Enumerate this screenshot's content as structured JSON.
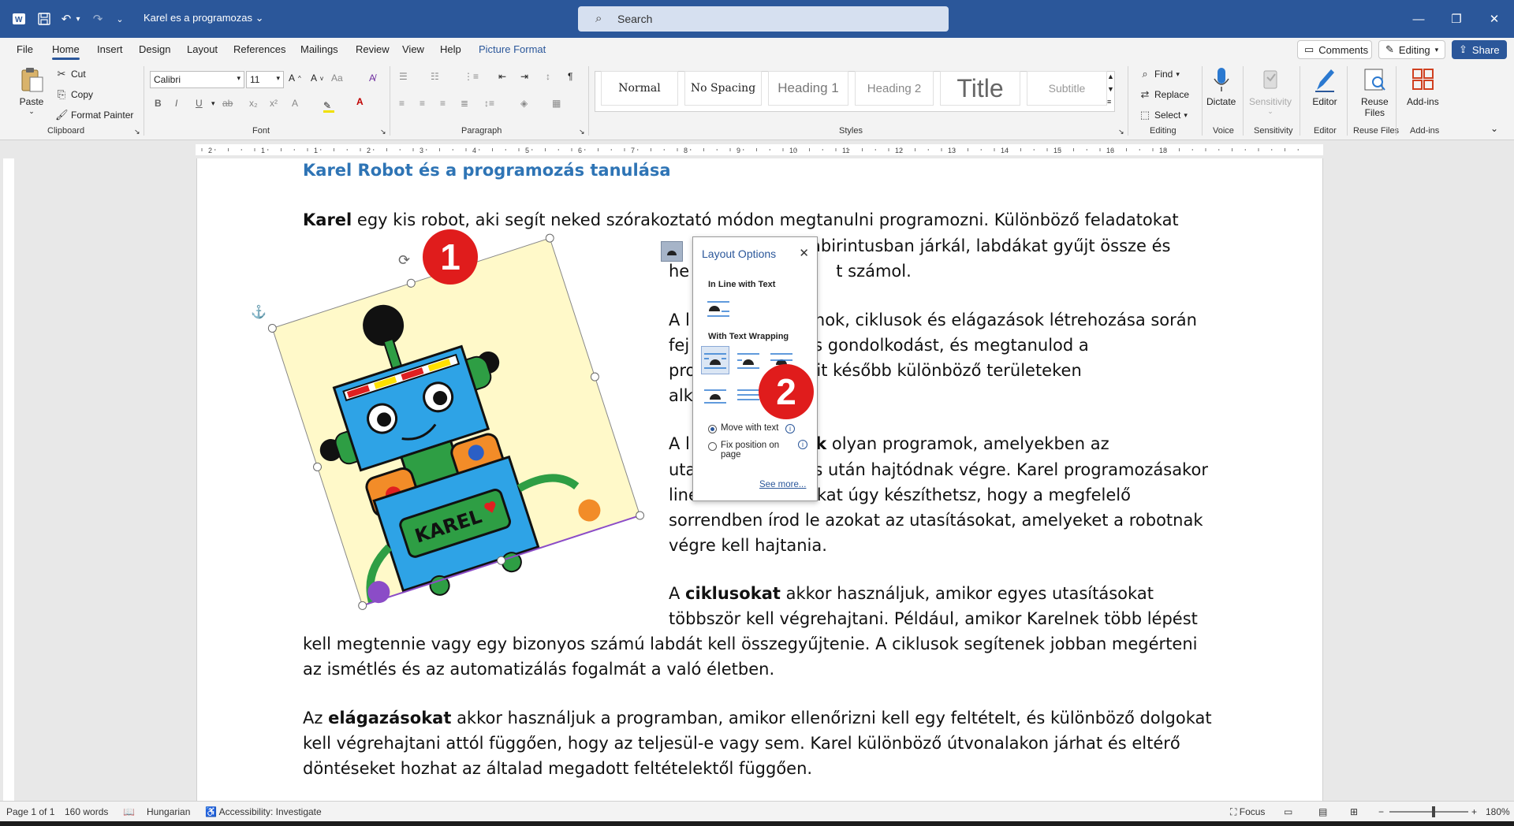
{
  "titlebar": {
    "document_title": "Karel es a programozas",
    "search_placeholder": "Search"
  },
  "menu_tabs": [
    "File",
    "Home",
    "Insert",
    "Design",
    "Layout",
    "References",
    "Mailings",
    "Review",
    "View",
    "Help",
    "Picture Format"
  ],
  "top_buttons": {
    "comments": "Comments",
    "editing": "Editing",
    "share": "Share"
  },
  "ribbon": {
    "clipboard": {
      "paste": "Paste",
      "cut": "Cut",
      "copy": "Copy",
      "format_painter": "Format Painter",
      "label": "Clipboard"
    },
    "font": {
      "family": "Calibri",
      "size": "11",
      "label": "Font"
    },
    "paragraph": {
      "label": "Paragraph"
    },
    "styles": {
      "items": [
        "Normal",
        "No Spacing",
        "Heading 1",
        "Heading 2",
        "Title",
        "Subtitle"
      ],
      "label": "Styles"
    },
    "editing": {
      "find": "Find",
      "replace": "Replace",
      "select": "Select",
      "label": "Editing"
    },
    "voice": {
      "dictate": "Dictate",
      "label": "Voice"
    },
    "sensitivity": {
      "button": "Sensitivity",
      "label": "Sensitivity"
    },
    "editor": {
      "button": "Editor",
      "label": "Editor"
    },
    "reuse_files": {
      "button_line1": "Reuse",
      "button_line2": "Files",
      "label": "Reuse Files"
    },
    "addins": {
      "button": "Add-ins",
      "label": "Add-ins"
    }
  },
  "ruler_numbers": [
    "2",
    "1",
    "1",
    "2",
    "3",
    "4",
    "5",
    "6",
    "7",
    "8",
    "9",
    "10",
    "11",
    "12",
    "13",
    "14",
    "15",
    "16",
    "18"
  ],
  "document": {
    "heading": "Karel Robot és a programozás tanulása",
    "p1_bold": "Karel",
    "p1_line1": " egy kis robot, aki segít neked szórakoztató módon megtanulni programozni. Különböző feladatokat",
    "p1_line2": "abirintusban járkál, labdákat gyűjt össze és",
    "p1_line3_a": "he",
    "p1_line3_b": "t számol.",
    "p2_l1_a": "A l",
    "p2_l1_b": "nok, ciklusok és elágazások létrehozása során",
    "p2_l2_a": "fej",
    "p2_l2_b": "s gondolkodást, és megtanulod a",
    "p2_l3_a": "pro",
    "p2_l3_b": "it később különböző területeken",
    "p2_l4": "alk",
    "p3_l1_a": "A l",
    "p3_l1_bold": "nok",
    "p3_l1_b": " olyan programok, amelyekben az",
    "p3_l2_a": "uta",
    "p3_l2_b": "s után hajtódnak végre. Karel programozásakor",
    "p3_l3_a": "line",
    "p3_l3_b": "kat úgy készíthetsz, hogy a megfelelő",
    "p3_l4": "sorrendben írod le azokat az utasításokat, amelyeket a robotnak",
    "p3_l5": "végre kell hajtania.",
    "p4_l1_a": "A ",
    "p4_l1_bold": "ciklusokat",
    "p4_l1_b": " akkor használjuk, amikor egyes utasításokat",
    "p4_l2": "többször kell végrehajtani. Például, amikor Karelnek több lépést",
    "p4_l3": "kell megtennie vagy egy bizonyos számú labdát kell összegyűjtenie. A ciklusok segítenek jobban megérteni",
    "p4_l4": "az ismétlés és az automatizálás fogalmát a való életben.",
    "p5_l1_a": "Az ",
    "p5_l1_bold": "elágazásokat",
    "p5_l1_b": " akkor használjuk a programban, amikor ellenőrizni kell egy feltételt, és különböző dolgokat",
    "p5_l2": "kell végrehajtani attól függően, hogy az teljesül-e vagy sem. Karel különböző útvonalakon járhat és eltérő",
    "p5_l3": "döntéseket hozhat az általad megadott feltételektől függően.",
    "robot_label": "KAREL"
  },
  "layout_options": {
    "title": "Layout Options",
    "inline_header": "In Line with Text",
    "wrapping_header": "With Text Wrapping",
    "move_with_text": "Move with text",
    "fix_position_l1": "Fix position on",
    "fix_position_l2": "page",
    "see_more": "See more...",
    "selected_option": "Move with text"
  },
  "badges": {
    "one": "1",
    "two": "2"
  },
  "statusbar": {
    "page": "Page 1 of 1",
    "words": "160 words",
    "language": "Hungarian",
    "accessibility": "Accessibility: Investigate",
    "focus": "Focus",
    "zoom": "180%"
  },
  "colors": {
    "brand": "#2b579a",
    "heading": "#2e74b5",
    "badge": "#e01c1c"
  }
}
